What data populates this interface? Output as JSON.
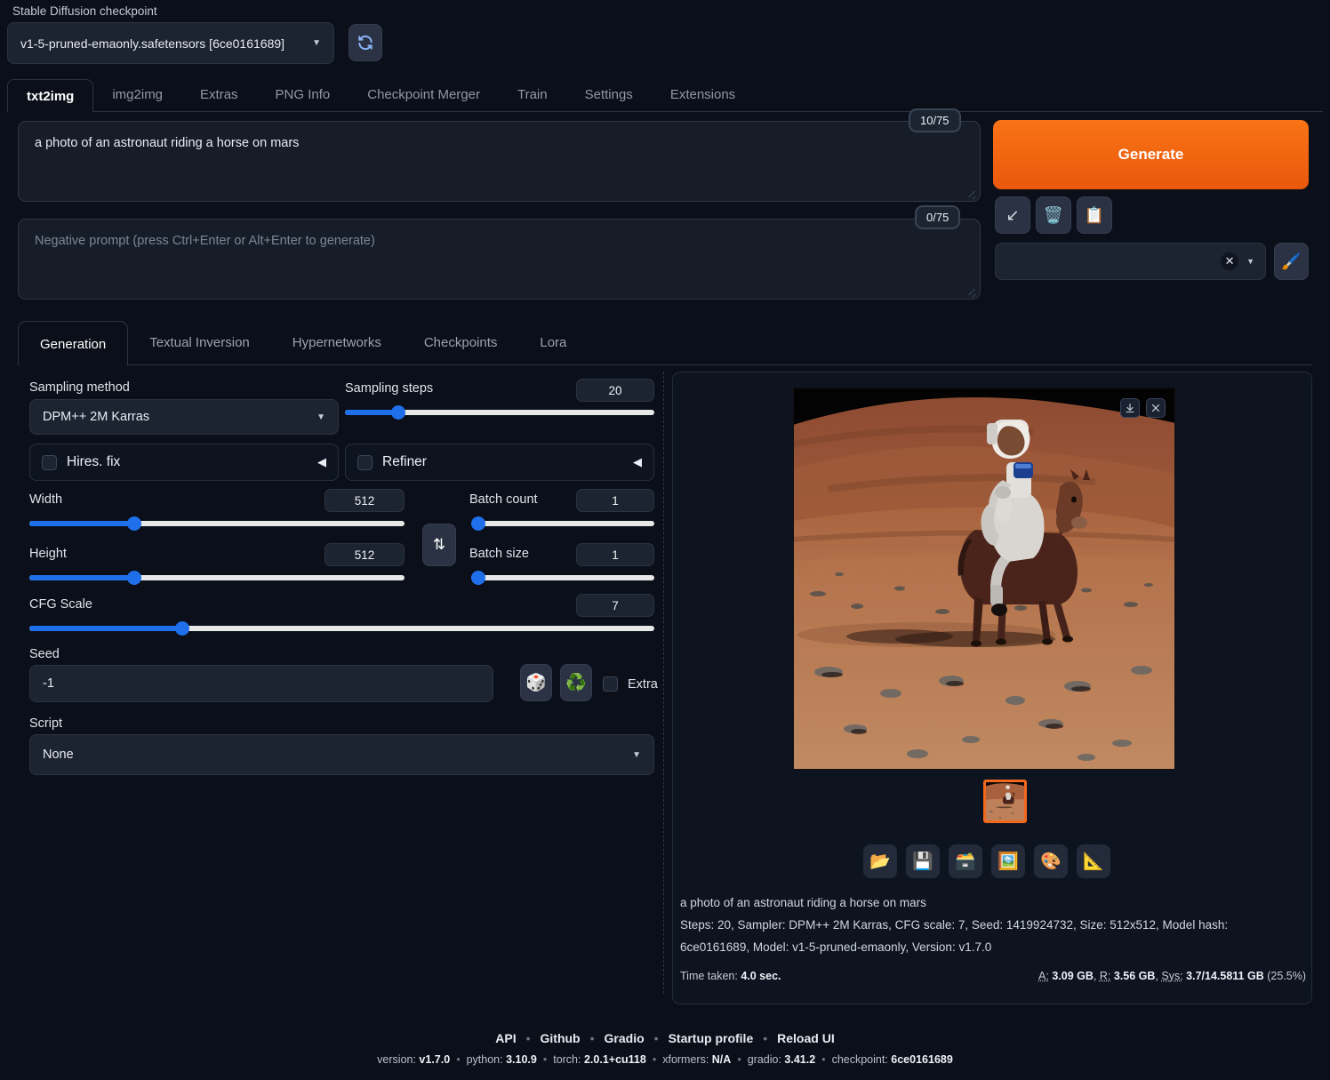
{
  "checkpoint": {
    "label": "Stable Diffusion checkpoint",
    "value": "v1-5-pruned-emaonly.safetensors [6ce0161689]",
    "caret": "▼",
    "refresh_icon": "refresh-icon"
  },
  "main_tabs": [
    {
      "label": "txt2img",
      "active": true
    },
    {
      "label": "img2img",
      "active": false
    },
    {
      "label": "Extras",
      "active": false
    },
    {
      "label": "PNG Info",
      "active": false
    },
    {
      "label": "Checkpoint Merger",
      "active": false
    },
    {
      "label": "Train",
      "active": false
    },
    {
      "label": "Settings",
      "active": false
    },
    {
      "label": "Extensions",
      "active": false
    }
  ],
  "prompt": {
    "positive_value": "a photo of an astronaut riding a horse on mars",
    "positive_tokens": "10/75",
    "negative_placeholder": "Negative prompt (press Ctrl+Enter or Alt+Enter to generate)",
    "negative_value": "",
    "negative_tokens": "0/75"
  },
  "actions": {
    "generate_label": "Generate",
    "arrow_icon": "↙",
    "trash_icon": "🗑️",
    "paste_icon": "📋",
    "styles_value": "",
    "styles_clear": "✕",
    "styles_caret": "▼",
    "brush_icon": "🖌️"
  },
  "sub_tabs": [
    {
      "label": "Generation",
      "active": true
    },
    {
      "label": "Textual Inversion",
      "active": false
    },
    {
      "label": "Hypernetworks",
      "active": false
    },
    {
      "label": "Checkpoints",
      "active": false
    },
    {
      "label": "Lora",
      "active": false
    }
  ],
  "settings": {
    "sampling_method_label": "Sampling method",
    "sampling_method_value": "DPM++ 2M Karras",
    "sampling_steps_label": "Sampling steps",
    "sampling_steps_value": "20",
    "hires_label": "Hires. fix",
    "refiner_label": "Refiner",
    "accordion_arrow": "◀",
    "width_label": "Width",
    "width_value": "512",
    "height_label": "Height",
    "height_value": "512",
    "batch_count_label": "Batch count",
    "batch_count_value": "1",
    "batch_size_label": "Batch size",
    "batch_size_value": "1",
    "cfg_label": "CFG Scale",
    "cfg_value": "7",
    "swap_icon": "⇅",
    "seed_label": "Seed",
    "seed_value": "-1",
    "dice_icon": "🎲",
    "recycle_icon": "♻️",
    "extra_label": "Extra",
    "script_label": "Script",
    "script_value": "None",
    "caret": "▼"
  },
  "result": {
    "download_icon": "download-icon",
    "close_icon": "close-icon",
    "tools": [
      {
        "icon": "📂",
        "name": "open-folder-icon"
      },
      {
        "icon": "💾",
        "name": "save-icon"
      },
      {
        "icon": "🗃️",
        "name": "save-zip-icon"
      },
      {
        "icon": "🖼️",
        "name": "send-to-img2img-icon"
      },
      {
        "icon": "🎨",
        "name": "send-to-inpaint-icon"
      },
      {
        "icon": "📐",
        "name": "send-to-extras-icon"
      }
    ],
    "info_prompt": "a photo of an astronaut riding a horse on mars",
    "info_params_line1": "Steps: 20, Sampler: DPM++ 2M Karras, CFG scale: 7, Seed: 1419924732, Size: 512x512, Model hash:",
    "info_params_line2": "6ce0161689, Model: v1-5-pruned-emaonly, Version: v1.7.0",
    "time_taken_label": "Time taken:",
    "time_taken_value": "4.0 sec.",
    "mem_a_label": "A:",
    "mem_a_value": "3.09 GB",
    "mem_r_label": "R:",
    "mem_r_value": "3.56 GB",
    "mem_sys_label": "Sys:",
    "mem_sys_value": "3.7/14.5811 GB",
    "mem_sys_pct": "(25.5%)"
  },
  "footer": {
    "links": [
      "API",
      "Github",
      "Gradio",
      "Startup profile",
      "Reload UI"
    ],
    "separator": "•",
    "version_items": [
      {
        "key": "version:",
        "value": "v1.7.0"
      },
      {
        "key": "python:",
        "value": "3.10.9"
      },
      {
        "key": "torch:",
        "value": "2.0.1+cu118"
      },
      {
        "key": "xformers:",
        "value": "N/A"
      },
      {
        "key": "gradio:",
        "value": "3.41.2"
      },
      {
        "key": "checkpoint:",
        "value": "6ce0161689"
      }
    ]
  },
  "colors": {
    "accent_orange": "#f97316",
    "slider_blue": "#1f6feb",
    "background": "#0b0f19",
    "panel": "#0e1320",
    "input": "#1d2431"
  }
}
